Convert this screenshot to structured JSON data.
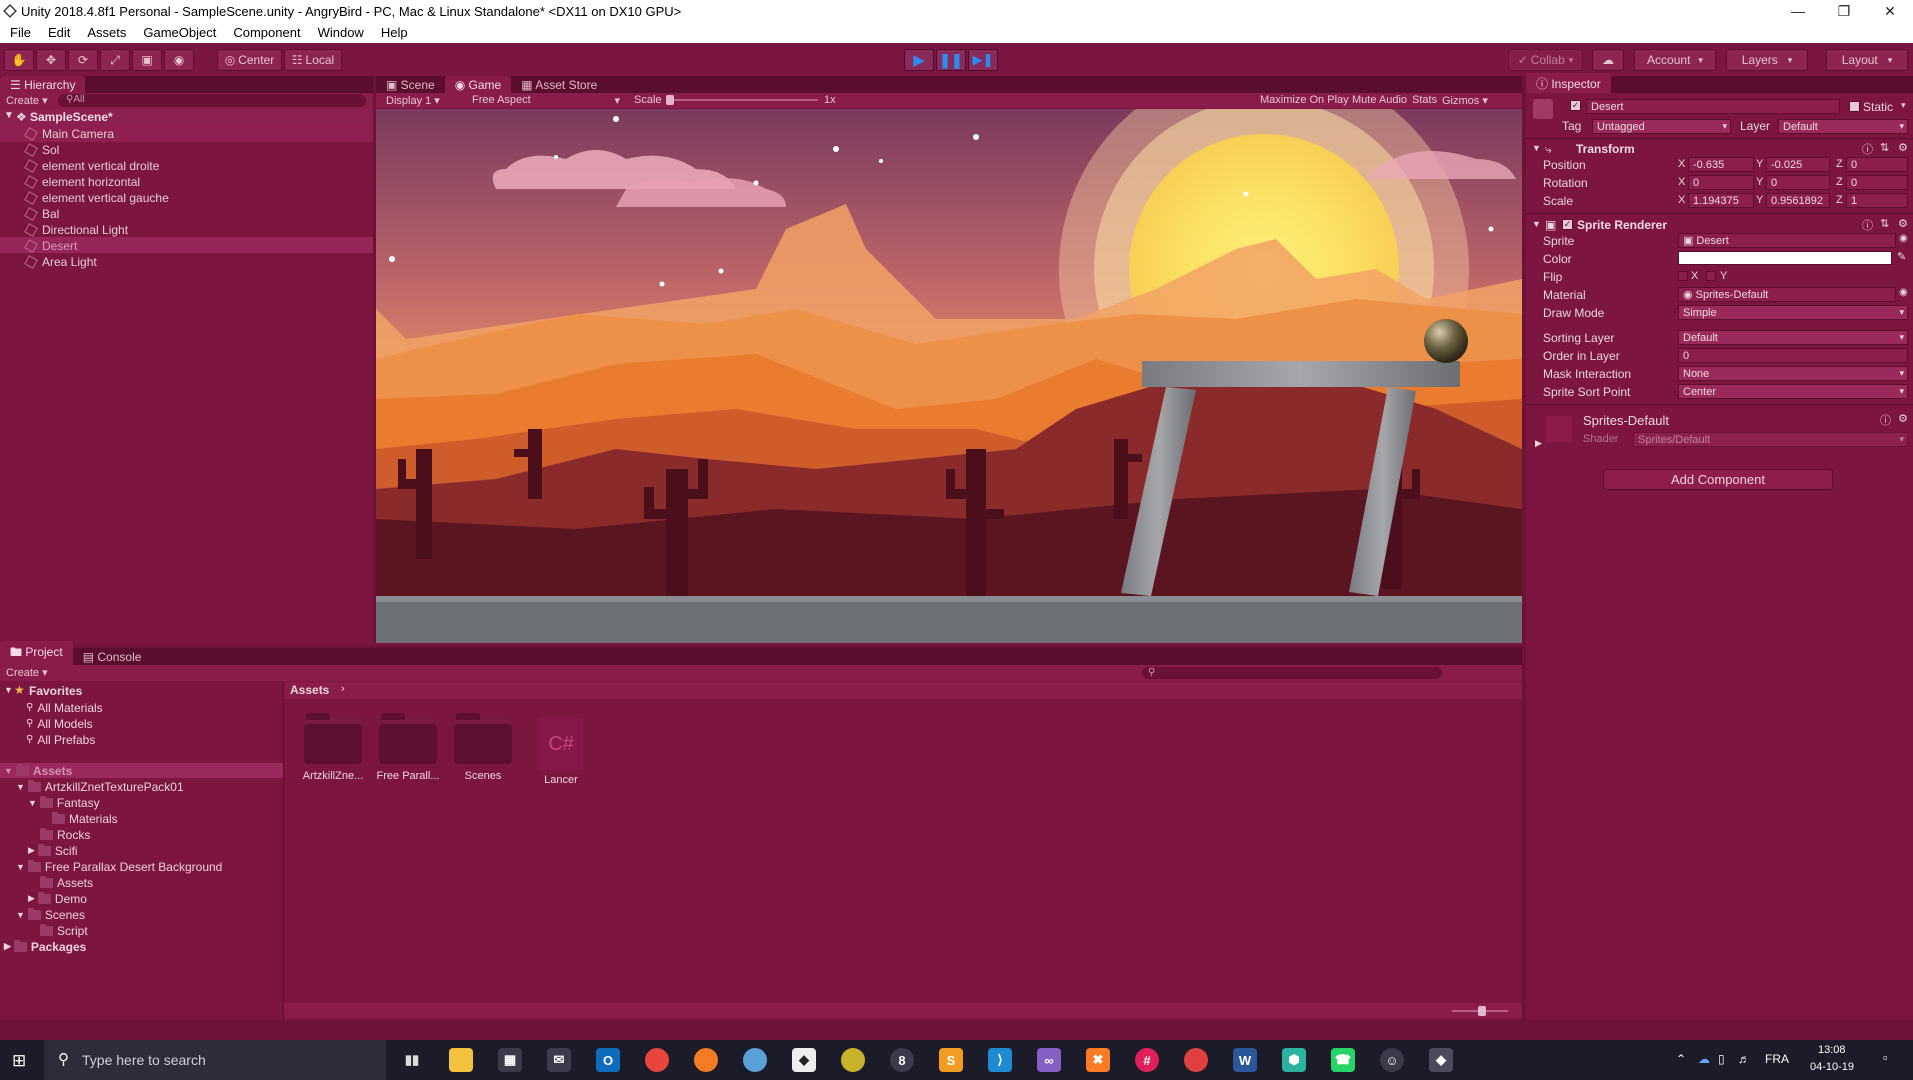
{
  "window": {
    "title": "Unity 2018.4.8f1 Personal - SampleScene.unity - AngryBird - PC, Mac & Linux Standalone* <DX11 on DX10 GPU>"
  },
  "menu": [
    "File",
    "Edit",
    "Assets",
    "GameObject",
    "Component",
    "Window",
    "Help"
  ],
  "toolbar": {
    "pivot": "Center",
    "space": "Local",
    "collab": "Collab",
    "account": "Account",
    "layers": "Layers",
    "layout": "Layout"
  },
  "hierarchy": {
    "tab": "Hierarchy",
    "create": "Create",
    "search_placeholder": "All",
    "scene": "SampleScene*",
    "items": [
      "Main Camera",
      "Sol",
      "element vertical droite",
      "element horizontal",
      "element vertical gauche",
      "Bal",
      "Directional Light",
      "Desert",
      "Area Light"
    ],
    "selected": "Desert"
  },
  "view_tabs": [
    "Scene",
    "Game",
    "Asset Store"
  ],
  "game_bar": {
    "display": "Display 1",
    "aspect": "Free Aspect",
    "scale_label": "Scale",
    "scale_value": "1x",
    "maximize": "Maximize On Play",
    "mute": "Mute Audio",
    "stats": "Stats",
    "gizmos": "Gizmos"
  },
  "inspector": {
    "tab": "Inspector",
    "object_name": "Desert",
    "static": "Static",
    "tag_label": "Tag",
    "tag_value": "Untagged",
    "layer_label": "Layer",
    "layer_value": "Default",
    "transform": {
      "title": "Transform",
      "position_label": "Position",
      "rotation_label": "Rotation",
      "scale_label": "Scale",
      "position": {
        "x": "-0.635",
        "y": "-0.025",
        "z": "0"
      },
      "rotation": {
        "x": "0",
        "y": "0",
        "z": "0"
      },
      "scale": {
        "x": "1.194375",
        "y": "0.9561892",
        "z": "1"
      }
    },
    "sprite_renderer": {
      "title": "Sprite Renderer",
      "sprite_label": "Sprite",
      "sprite_value": "Desert",
      "color_label": "Color",
      "flip_label": "Flip",
      "flip_x": "X",
      "flip_y": "Y",
      "material_label": "Material",
      "material_value": "Sprites-Default",
      "draw_mode_label": "Draw Mode",
      "draw_mode_value": "Simple",
      "sorting_layer_label": "Sorting Layer",
      "sorting_layer_value": "Default",
      "order_label": "Order in Layer",
      "order_value": "0",
      "mask_label": "Mask Interaction",
      "mask_value": "None",
      "sort_point_label": "Sprite Sort Point",
      "sort_point_value": "Center"
    },
    "material": {
      "name": "Sprites-Default",
      "shader_label": "Shader",
      "shader_value": "Sprites/Default"
    },
    "add_component": "Add Component"
  },
  "project": {
    "tabs": [
      "Project",
      "Console"
    ],
    "create": "Create",
    "favorites": "Favorites",
    "fav_items": [
      "All Materials",
      "All Models",
      "All Prefabs"
    ],
    "assets_root": "Assets",
    "tree": [
      {
        "label": "ArtzkillZnetTexturePack01",
        "depth": 1
      },
      {
        "label": "Fantasy",
        "depth": 2
      },
      {
        "label": "Materials",
        "depth": 3
      },
      {
        "label": "Rocks",
        "depth": 2
      },
      {
        "label": "Scifi",
        "depth": 2
      },
      {
        "label": "Free Parallax Desert Background",
        "depth": 1
      },
      {
        "label": "Assets",
        "depth": 2
      },
      {
        "label": "Demo",
        "depth": 2
      },
      {
        "label": "Scenes",
        "depth": 1
      },
      {
        "label": "Script",
        "depth": 2
      }
    ],
    "packages": "Packages",
    "breadcrumb": "Assets",
    "assets": [
      {
        "label": "ArtzkillZne...",
        "kind": "folder"
      },
      {
        "label": "Free Parall...",
        "kind": "folder"
      },
      {
        "label": "Scenes",
        "kind": "folder"
      },
      {
        "label": "Lancer",
        "kind": "script",
        "glyph": "C#"
      }
    ]
  },
  "taskbar": {
    "search_placeholder": "Type here to search",
    "language": "FRA",
    "time": "13:08",
    "date": "04-10-19"
  }
}
